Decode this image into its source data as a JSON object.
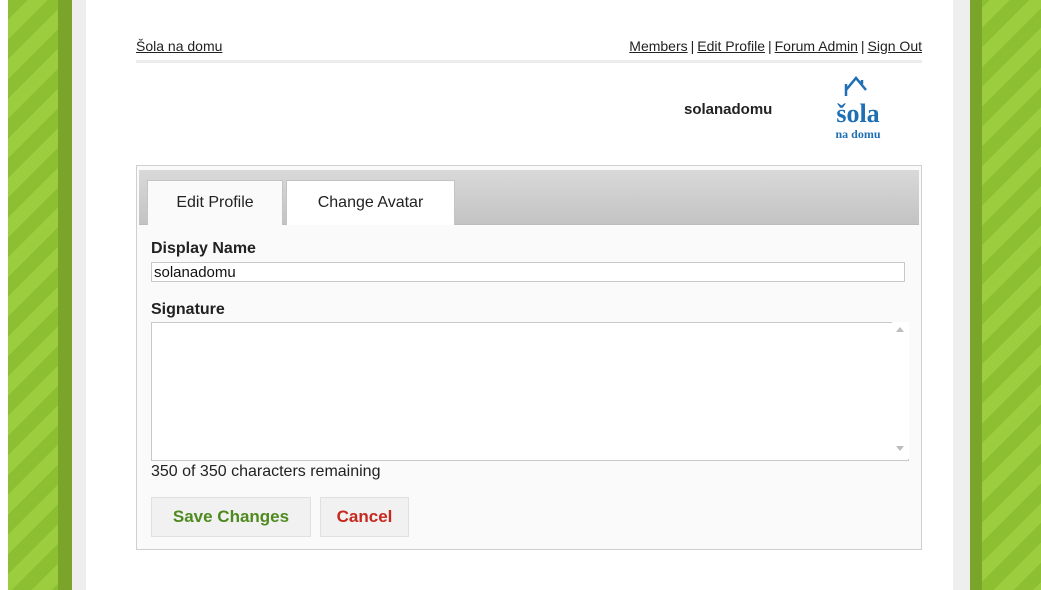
{
  "header": {
    "site_name": "Šola na domu",
    "nav": [
      "Members",
      "Edit Profile",
      "Forum Admin",
      "Sign Out"
    ],
    "nav_separator": "|",
    "username": "solanadomu",
    "logo_text_top": "šola",
    "logo_text_bottom": "na domu"
  },
  "tabs": {
    "edit_profile": "Edit Profile",
    "change_avatar": "Change Avatar"
  },
  "form": {
    "display_name_label": "Display Name",
    "display_name_value": "solanadomu",
    "signature_label": "Signature",
    "signature_value": "",
    "remaining_text": "350 of 350 characters remaining",
    "save_label": "Save Changes",
    "cancel_label": "Cancel"
  },
  "colors": {
    "stripe_green": "#8dbf32",
    "save_green": "#4f8a1f",
    "cancel_red": "#c7281e",
    "logo_blue": "#1f6fb5"
  }
}
